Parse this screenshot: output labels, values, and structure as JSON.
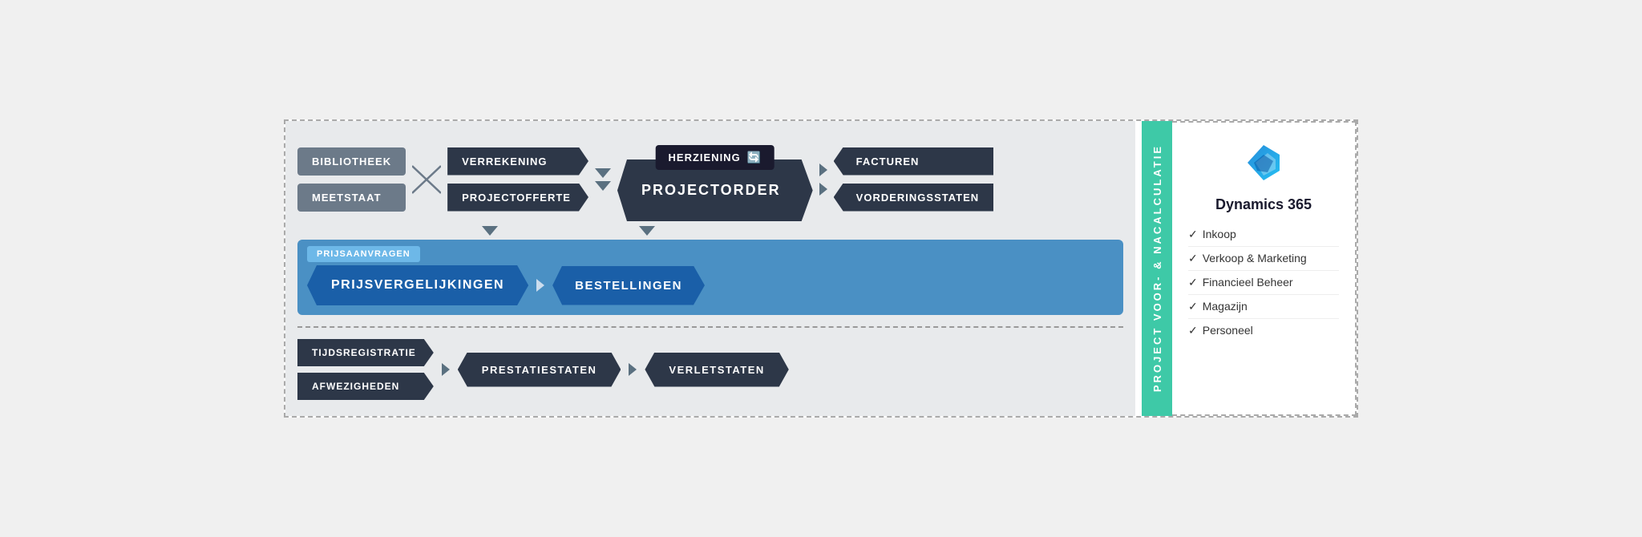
{
  "left": {
    "bibliotheek": "BIBLIOTHEEK",
    "meetstaat": "MEETSTAAT"
  },
  "top": {
    "verrekening": "VERREKENING",
    "projectofferte": "PROJECTOFFERTE",
    "herziening": "HERZIENING",
    "projectorder": "PROJECTORDER",
    "facturen": "FACTUREN",
    "vorderingsstaten": "VORDERINGSSTATEN"
  },
  "middle": {
    "prijsaanvragen": "PRIJSAANVRAGEN",
    "prijsvergelijkingen": "PRIJSVERGELIJKINGEN",
    "bestellingen": "BESTELLINGEN"
  },
  "bottom": {
    "tijdsregistratie": "TIJDSREGISTRATIE",
    "afwezigheden": "AFWEZIGHEDEN",
    "prestatiestaten": "PRESTATIESTATEN",
    "verletstaten": "VERLETSTATEN"
  },
  "sidebar": {
    "title": "PROJECT VOOR- & NACALCULATIE",
    "bgcolor": "#3ec9a7"
  },
  "dynamics": {
    "title": "Dynamics 365",
    "logo_color": "#0078d4",
    "checklist": [
      "Inkoop",
      "Verkoop & Marketing",
      "Financieel Beheer",
      "Magazijn",
      "Personeel"
    ]
  }
}
